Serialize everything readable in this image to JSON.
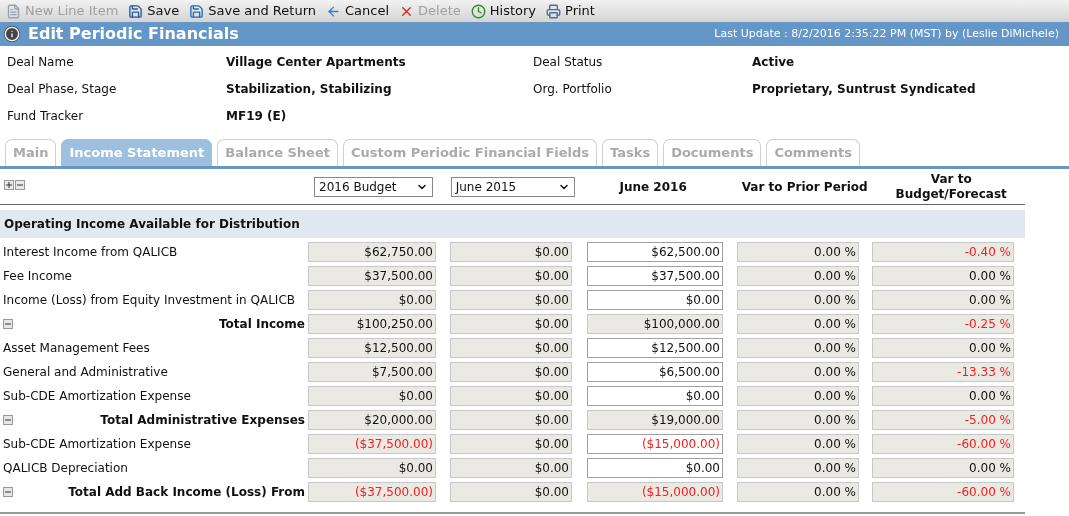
{
  "toolbar": [
    {
      "kind": "new",
      "label": "New Line Item",
      "disabled": true
    },
    {
      "kind": "save",
      "label": "Save",
      "disabled": false
    },
    {
      "kind": "save_return",
      "label": "Save and Return",
      "disabled": false
    },
    {
      "kind": "cancel",
      "label": "Cancel",
      "disabled": false
    },
    {
      "kind": "delete",
      "label": "Delete",
      "disabled": true
    },
    {
      "kind": "history",
      "label": "History",
      "disabled": false
    },
    {
      "kind": "print",
      "label": "Print",
      "disabled": false
    }
  ],
  "title_bar": {
    "title": "Edit Periodic Financials",
    "last_update": "Last Update : 8/2/2016 2:35:22 PM (MST) by (Leslie DiMichele)"
  },
  "deal_info": [
    [
      {
        "label": "Deal Name",
        "value": "Village Center Apartments"
      },
      {
        "label": "Deal Status",
        "value": "Active"
      }
    ],
    [
      {
        "label": "Deal Phase, Stage",
        "value": "Stabilization, Stabilizing"
      },
      {
        "label": "Org. Portfolio",
        "value": "Proprietary, Suntrust Syndicated"
      }
    ],
    [
      {
        "label": "Fund Tracker",
        "value": "MF19 (E)"
      }
    ]
  ],
  "tabs": [
    {
      "label": "Main",
      "selected": false
    },
    {
      "label": "Income Statement",
      "selected": true
    },
    {
      "label": "Balance Sheet",
      "selected": false
    },
    {
      "label": "Custom Periodic Financial Fields",
      "selected": false
    },
    {
      "label": "Tasks",
      "selected": false
    },
    {
      "label": "Documents",
      "selected": false
    },
    {
      "label": "Comments",
      "selected": false
    }
  ],
  "table": {
    "budget_select": "2016 Budget",
    "prior_select": "June 2015",
    "current_heading": "June 2016",
    "var_prior_heading": "Var to Prior Period",
    "var_budget_heading": "Var to Budget/Forecast",
    "section": "Operating Income Available for Distribution",
    "rows": [
      {
        "kind": "line",
        "label": "Interest Income from QALICB",
        "cells": [
          {
            "text": "$62,750.00",
            "negative": false
          },
          {
            "text": "$0.00",
            "negative": false
          },
          {
            "text": "$62,500.00",
            "negative": false
          },
          {
            "text": "0.00 %",
            "negative": false
          },
          {
            "text": "-0.40 %",
            "negative": true
          }
        ]
      },
      {
        "kind": "line",
        "label": "Fee Income",
        "cells": [
          {
            "text": "$37,500.00",
            "negative": false
          },
          {
            "text": "$0.00",
            "negative": false
          },
          {
            "text": "$37,500.00",
            "negative": false
          },
          {
            "text": "0.00 %",
            "negative": false
          },
          {
            "text": "0.00 %",
            "negative": false
          }
        ]
      },
      {
        "kind": "line",
        "label": "Income (Loss) from Equity Investment in QALICB",
        "cells": [
          {
            "text": "$0.00",
            "negative": false
          },
          {
            "text": "$0.00",
            "negative": false
          },
          {
            "text": "$0.00",
            "negative": false
          },
          {
            "text": "0.00 %",
            "negative": false
          },
          {
            "text": "0.00 %",
            "negative": false
          }
        ]
      },
      {
        "kind": "total",
        "label": "Total Income",
        "cells": [
          {
            "text": "$100,250.00",
            "negative": false
          },
          {
            "text": "$0.00",
            "negative": false
          },
          {
            "text": "$100,000.00",
            "negative": false
          },
          {
            "text": "0.00 %",
            "negative": false
          },
          {
            "text": "-0.25 %",
            "negative": true
          }
        ]
      },
      {
        "kind": "line",
        "label": "Asset Management Fees",
        "cells": [
          {
            "text": "$12,500.00",
            "negative": false
          },
          {
            "text": "$0.00",
            "negative": false
          },
          {
            "text": "$12,500.00",
            "negative": false
          },
          {
            "text": "0.00 %",
            "negative": false
          },
          {
            "text": "0.00 %",
            "negative": false
          }
        ]
      },
      {
        "kind": "line",
        "label": "General and Administrative",
        "cells": [
          {
            "text": "$7,500.00",
            "negative": false
          },
          {
            "text": "$0.00",
            "negative": false
          },
          {
            "text": "$6,500.00",
            "negative": false
          },
          {
            "text": "0.00 %",
            "negative": false
          },
          {
            "text": "-13.33 %",
            "negative": true
          }
        ]
      },
      {
        "kind": "line",
        "label": "Sub-CDE Amortization Expense",
        "cells": [
          {
            "text": "$0.00",
            "negative": false
          },
          {
            "text": "$0.00",
            "negative": false
          },
          {
            "text": "$0.00",
            "negative": false
          },
          {
            "text": "0.00 %",
            "negative": false
          },
          {
            "text": "0.00 %",
            "negative": false
          }
        ]
      },
      {
        "kind": "total",
        "label": "Total Administrative Expenses",
        "cells": [
          {
            "text": "$20,000.00",
            "negative": false
          },
          {
            "text": "$0.00",
            "negative": false
          },
          {
            "text": "$19,000.00",
            "negative": false
          },
          {
            "text": "0.00 %",
            "negative": false
          },
          {
            "text": "-5.00 %",
            "negative": true
          }
        ]
      },
      {
        "kind": "line",
        "label": "Sub-CDE Amortization Expense",
        "cells": [
          {
            "text": "($37,500.00)",
            "negative": true
          },
          {
            "text": "$0.00",
            "negative": false
          },
          {
            "text": "($15,000.00)",
            "negative": true
          },
          {
            "text": "0.00 %",
            "negative": false
          },
          {
            "text": "-60.00 %",
            "negative": true
          }
        ]
      },
      {
        "kind": "line",
        "label": "QALICB Depreciation",
        "cells": [
          {
            "text": "$0.00",
            "negative": false
          },
          {
            "text": "$0.00",
            "negative": false
          },
          {
            "text": "$0.00",
            "negative": false
          },
          {
            "text": "0.00 %",
            "negative": false
          },
          {
            "text": "0.00 %",
            "negative": false
          }
        ]
      },
      {
        "kind": "total",
        "label": "Total Add Back Income (Loss) From",
        "cells": [
          {
            "text": "($37,500.00)",
            "negative": true
          },
          {
            "text": "$0.00",
            "negative": false
          },
          {
            "text": "($15,000.00)",
            "negative": true
          },
          {
            "text": "0.00 %",
            "negative": false
          },
          {
            "text": "-60.00 %",
            "negative": true
          }
        ]
      }
    ]
  }
}
